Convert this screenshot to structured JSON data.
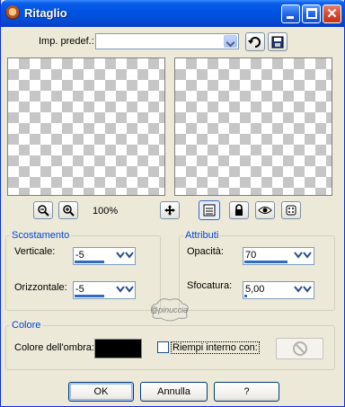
{
  "window": {
    "title": "Ritaglio"
  },
  "presets": {
    "label": "Imp. predef.:",
    "value": ""
  },
  "zoom": {
    "level": "100%"
  },
  "offset": {
    "title": "Scostamento",
    "vertical_label": "Verticale:",
    "vertical_value": "-5",
    "horizontal_label": "Orizzontale:",
    "horizontal_value": "-5"
  },
  "attributes": {
    "title": "Attributi",
    "opacity_label": "Opacità:",
    "opacity_value": "70",
    "blur_label": "Sfocatura:",
    "blur_value": "5,00"
  },
  "color": {
    "title": "Colore",
    "shadow_label": "Colore dell'ombra:",
    "shadow_color": "#000000",
    "fill_label": "Riempi interno con:",
    "fill_checked": false
  },
  "watermark": {
    "text": "@pinuccia"
  },
  "buttons": {
    "ok": "OK",
    "cancel": "Annulla",
    "help": "?"
  },
  "icons": {
    "app": "app-icon",
    "minimize": "minimize-icon",
    "maximize": "maximize-icon",
    "close": "close-icon",
    "reset": "reset-icon",
    "save": "save-icon",
    "zoom_out": "zoom-out-icon",
    "zoom_in": "zoom-in-icon",
    "pan": "pan-icon",
    "proof": "proof-icon",
    "lock": "lock-icon",
    "eye": "eye-icon",
    "randomize": "dice-icon",
    "no_fill": "no-symbol-icon"
  }
}
